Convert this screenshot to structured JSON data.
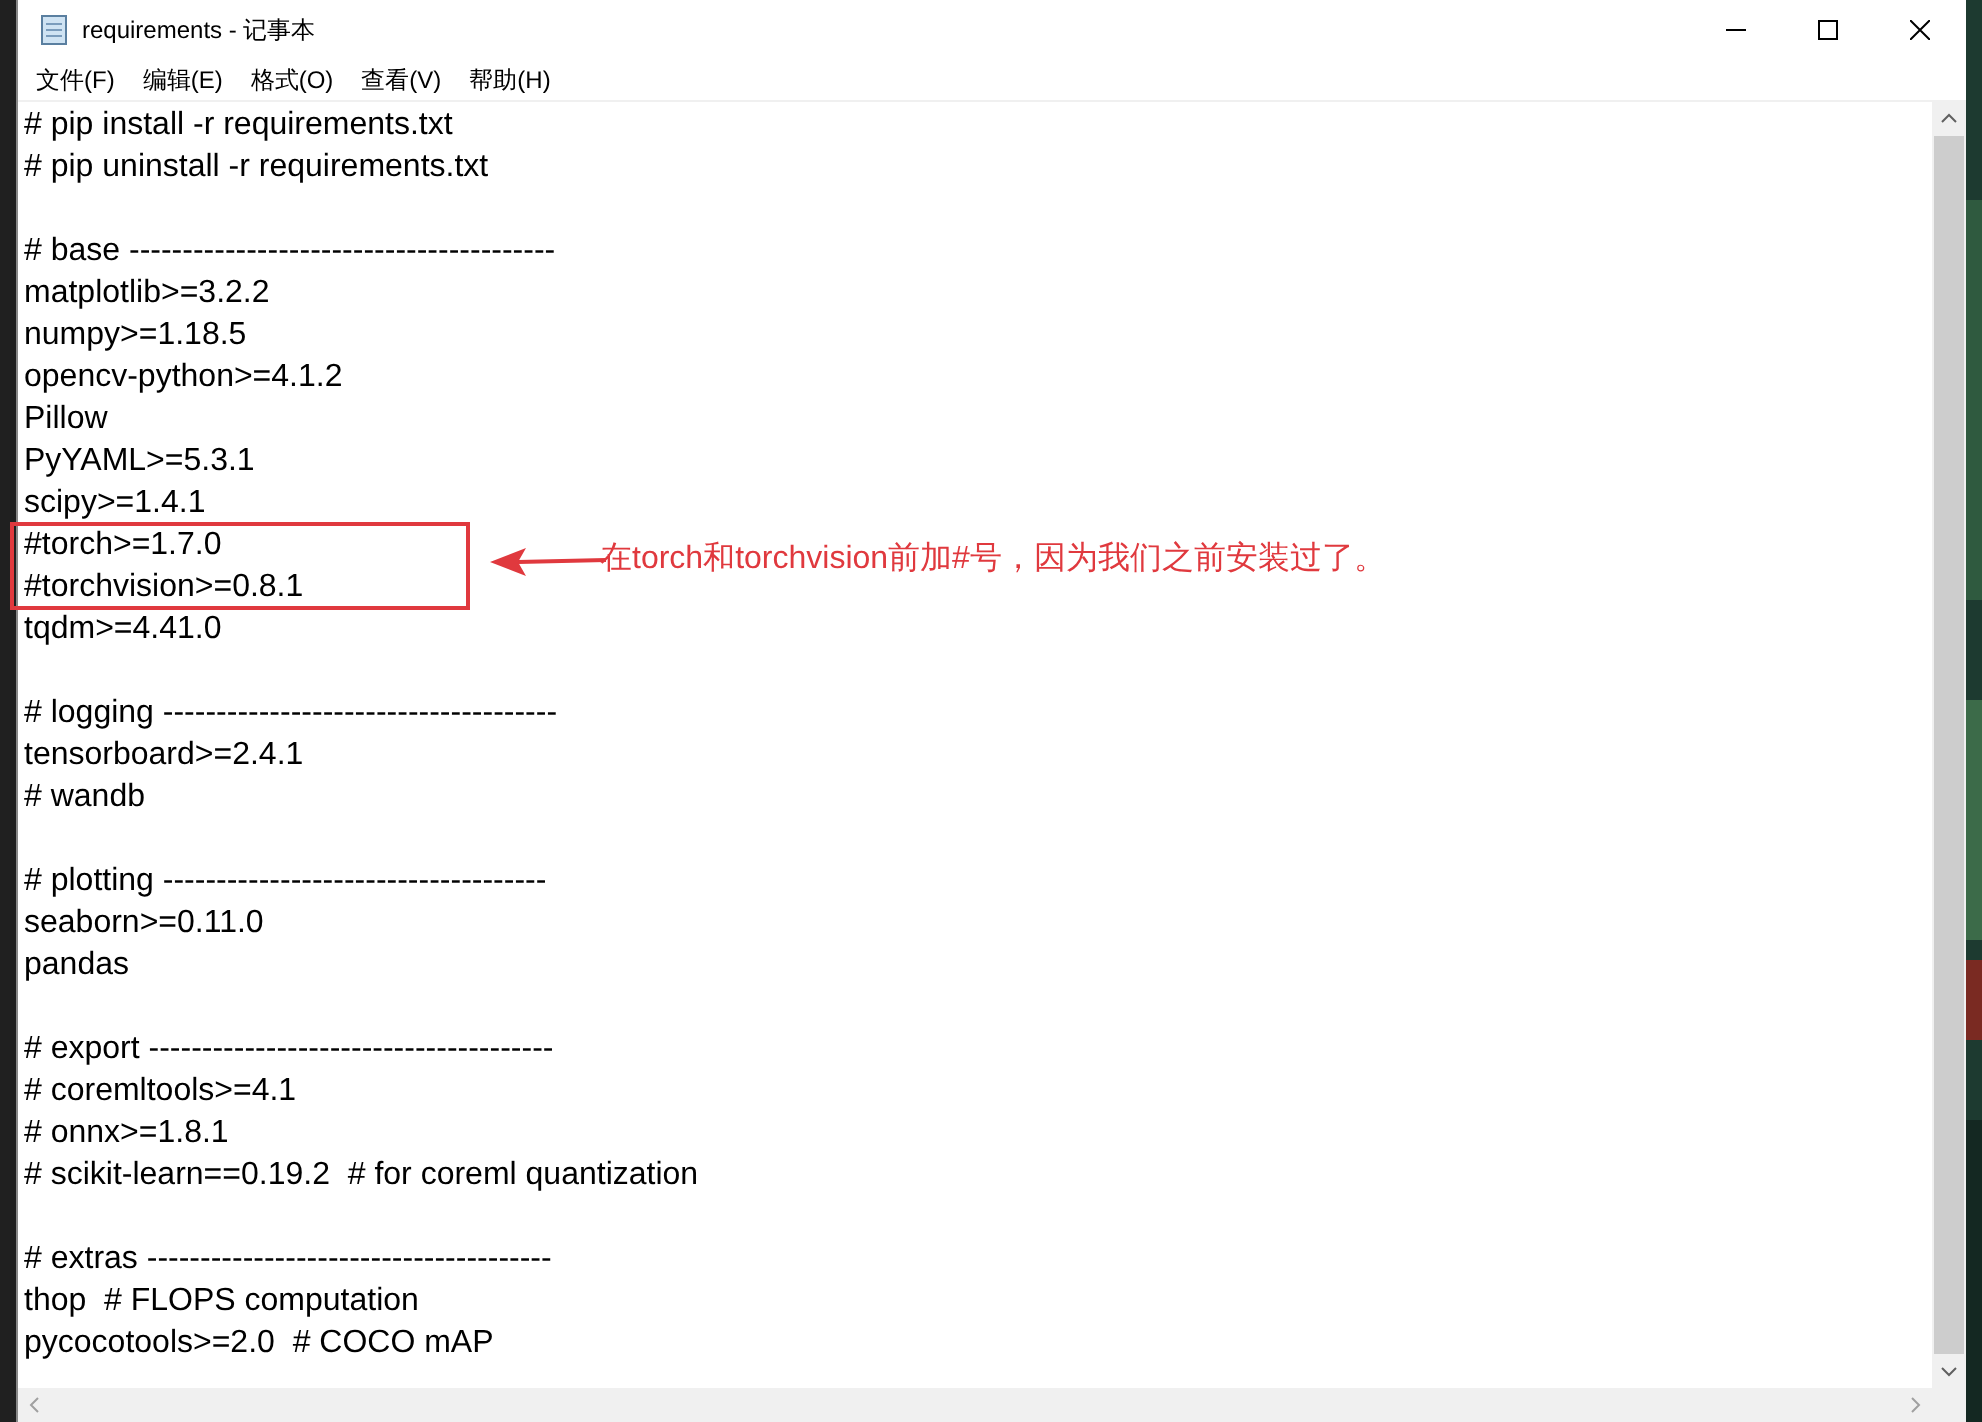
{
  "window": {
    "title": "requirements - 记事本"
  },
  "menu": [
    "文件(F)",
    "编辑(E)",
    "格式(O)",
    "查看(V)",
    "帮助(H)"
  ],
  "blocks": [
    [
      "# pip install -r requirements.txt",
      "# pip uninstall -r requirements.txt"
    ],
    [
      "# base ----------------------------------------",
      "matplotlib>=3.2.2",
      "numpy>=1.18.5",
      "opencv-python>=4.1.2",
      "Pillow",
      "PyYAML>=5.3.1",
      "scipy>=1.4.1",
      "#torch>=1.7.0",
      "#torchvision>=0.8.1",
      "tqdm>=4.41.0"
    ],
    [
      "# logging -------------------------------------",
      "tensorboard>=2.4.1",
      "# wandb"
    ],
    [
      "# plotting ------------------------------------",
      "seaborn>=0.11.0",
      "pandas"
    ],
    [
      "# export --------------------------------------",
      "# coremltools>=4.1",
      "# onnx>=1.8.1",
      "# scikit-learn==0.19.2  # for coreml quantization"
    ],
    [
      "# extras --------------------------------------",
      "thop  # FLOPS computation",
      "pycocotools>=2.0  # COCO mAP"
    ]
  ],
  "annotation": {
    "text": "在torch和torchvision前加#号，因为我们之前安装过了。"
  }
}
